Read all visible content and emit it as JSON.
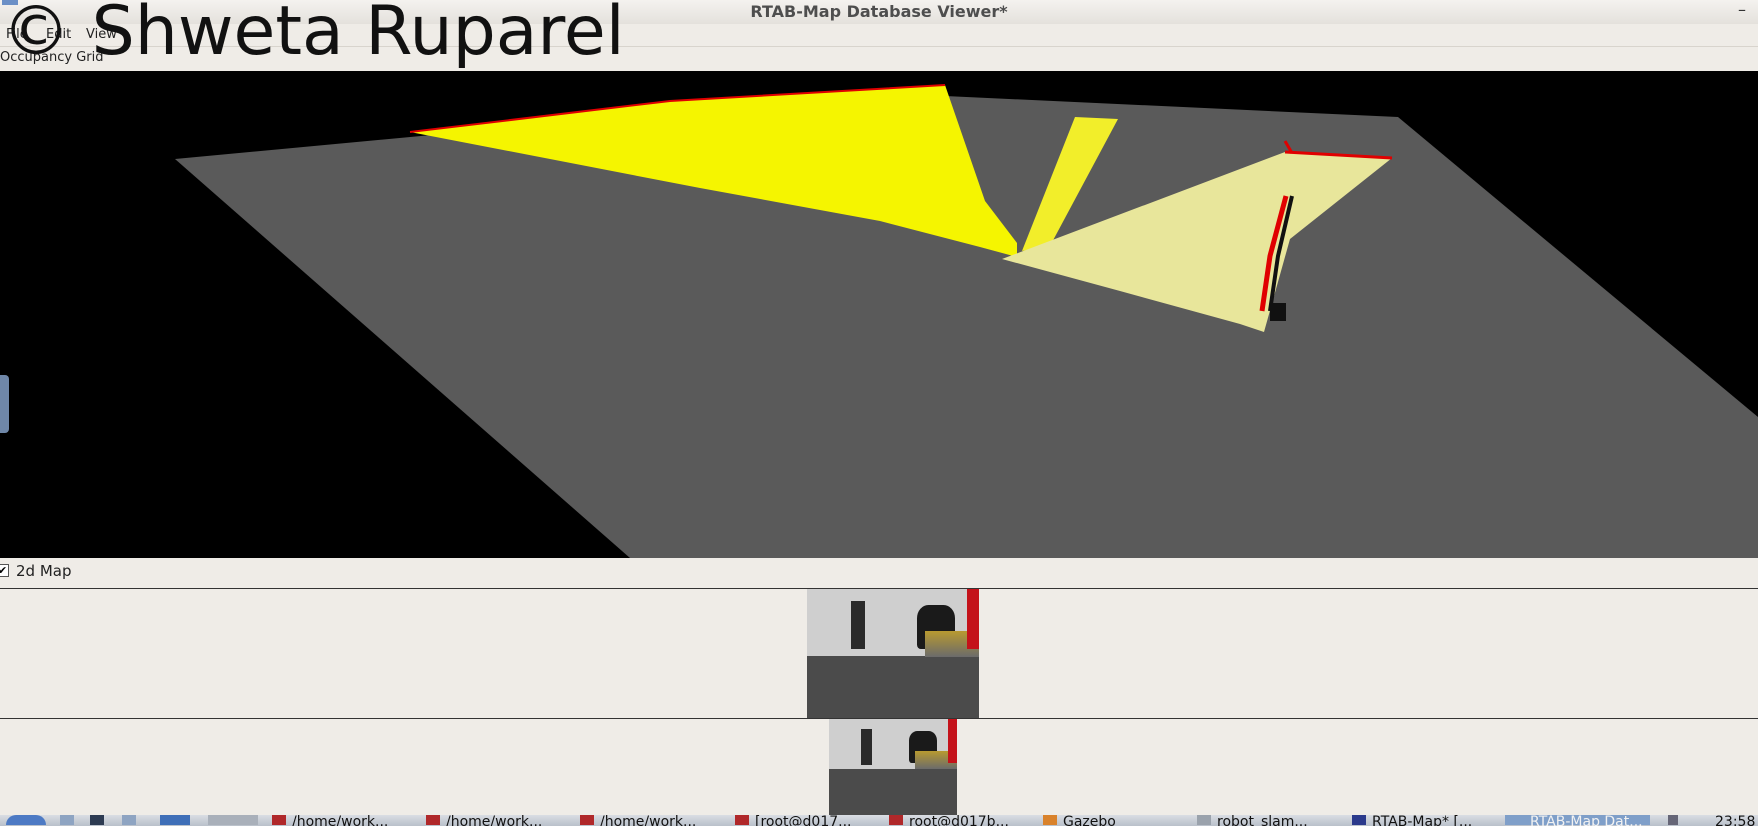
{
  "window": {
    "title": "RTAB-Map Database Viewer*"
  },
  "watermark": "© Shweta Ruparel",
  "menu": {
    "file": "File",
    "edit": "Edit",
    "view": "View"
  },
  "dock": {
    "occupancy_title": "Occupancy Grid"
  },
  "map_panel": {
    "checkbox_label": "2d Map",
    "checked": true,
    "check_mark": "✔"
  },
  "controls": {
    "minimize": "–"
  },
  "taskbar": {
    "items": [
      "/home/work...",
      "/home/work...",
      "/home/work...",
      "[root@d017...",
      "root@d017b...",
      "Gazebo",
      "robot_slam...",
      "RTAB-Map* [...",
      "RTAB-Map Dat..."
    ],
    "clock": "23:58"
  },
  "colors": {
    "free_cells": "#f5f500",
    "obstacle_cells": "#e00000",
    "unknown": "#5a5a5a",
    "background": "#000000"
  }
}
